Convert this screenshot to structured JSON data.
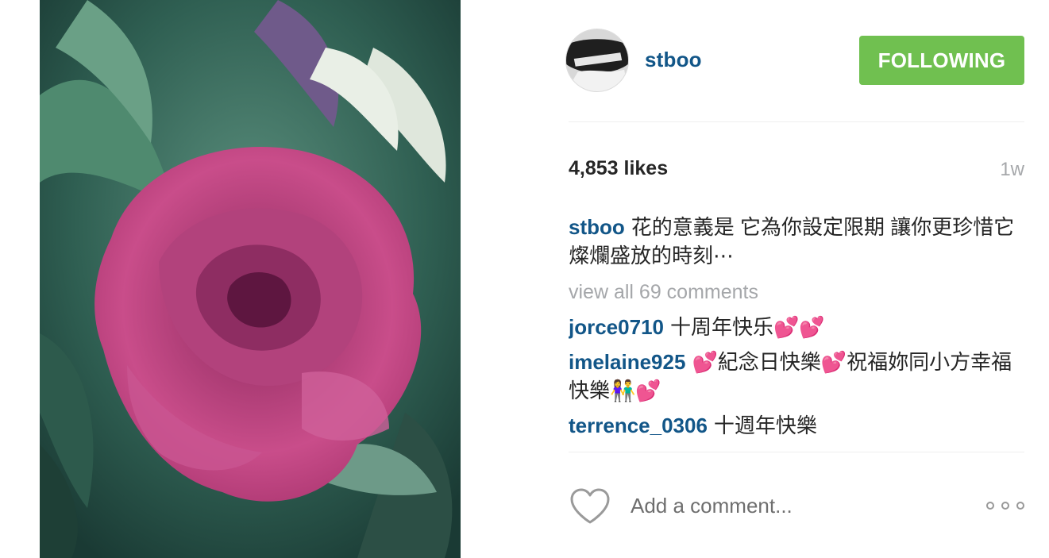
{
  "post": {
    "username": "stboo",
    "follow_label": "FOLLOWING",
    "likes": "4,853 likes",
    "time_ago": "1w",
    "caption": {
      "author": "stboo",
      "text": "花的意義是 它為你設定限期 讓你更珍惜它燦爛盛放的時刻⋯"
    },
    "view_all_label": "view all 69 comments",
    "comments": [
      {
        "author": "jorce0710",
        "text": "十周年快乐💕💕"
      },
      {
        "author": "imelaine925",
        "text": "💕紀念日快樂💕祝福妳同小方幸福快樂👫💕"
      },
      {
        "author": "terrence_0306",
        "text": "十週年快樂"
      }
    ],
    "comment_placeholder": "Add a comment...",
    "icons": {
      "like": "heart-outline-icon",
      "more": "more-options-icon"
    }
  },
  "colors": {
    "follow_button": "#70c050",
    "username_link": "#125688",
    "muted_text": "#a5a7aa"
  }
}
